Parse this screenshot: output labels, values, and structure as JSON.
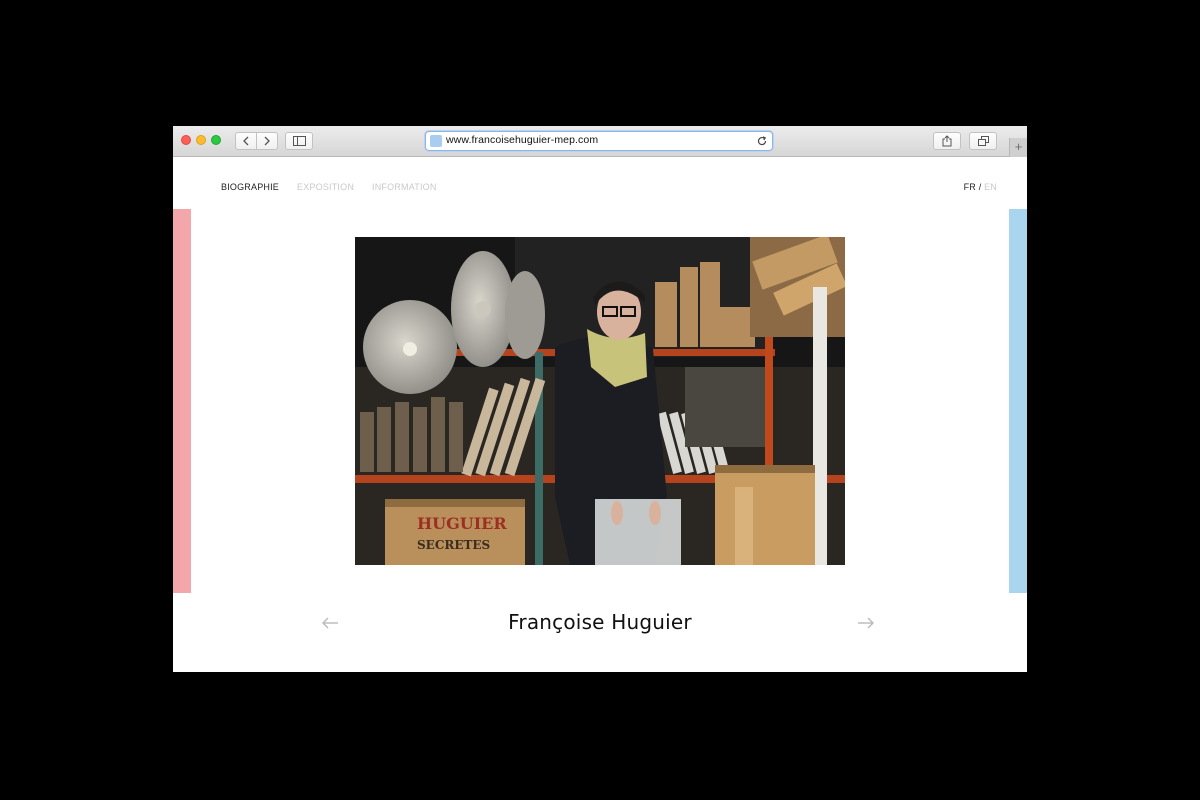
{
  "browser": {
    "url": "www.francoisehuguier-mep.com",
    "new_tab": "+"
  },
  "nav": {
    "items": [
      {
        "label": "BIOGRAPHIE"
      },
      {
        "label": "EXPOSITION"
      },
      {
        "label": "INFORMATION"
      }
    ]
  },
  "lang": {
    "fr": "FR",
    "sep": "/",
    "en": "EN"
  },
  "photo": {
    "crate_text_1": "HUGUIER",
    "crate_text_2": "SECRETES"
  },
  "caption": {
    "name": "Françoise Huguier"
  },
  "colors": {
    "accent_left": "#f3a7aa",
    "accent_right": "#a9d6ee"
  },
  "icons": {
    "prev": "arrow-left-icon",
    "next": "arrow-right-icon"
  }
}
